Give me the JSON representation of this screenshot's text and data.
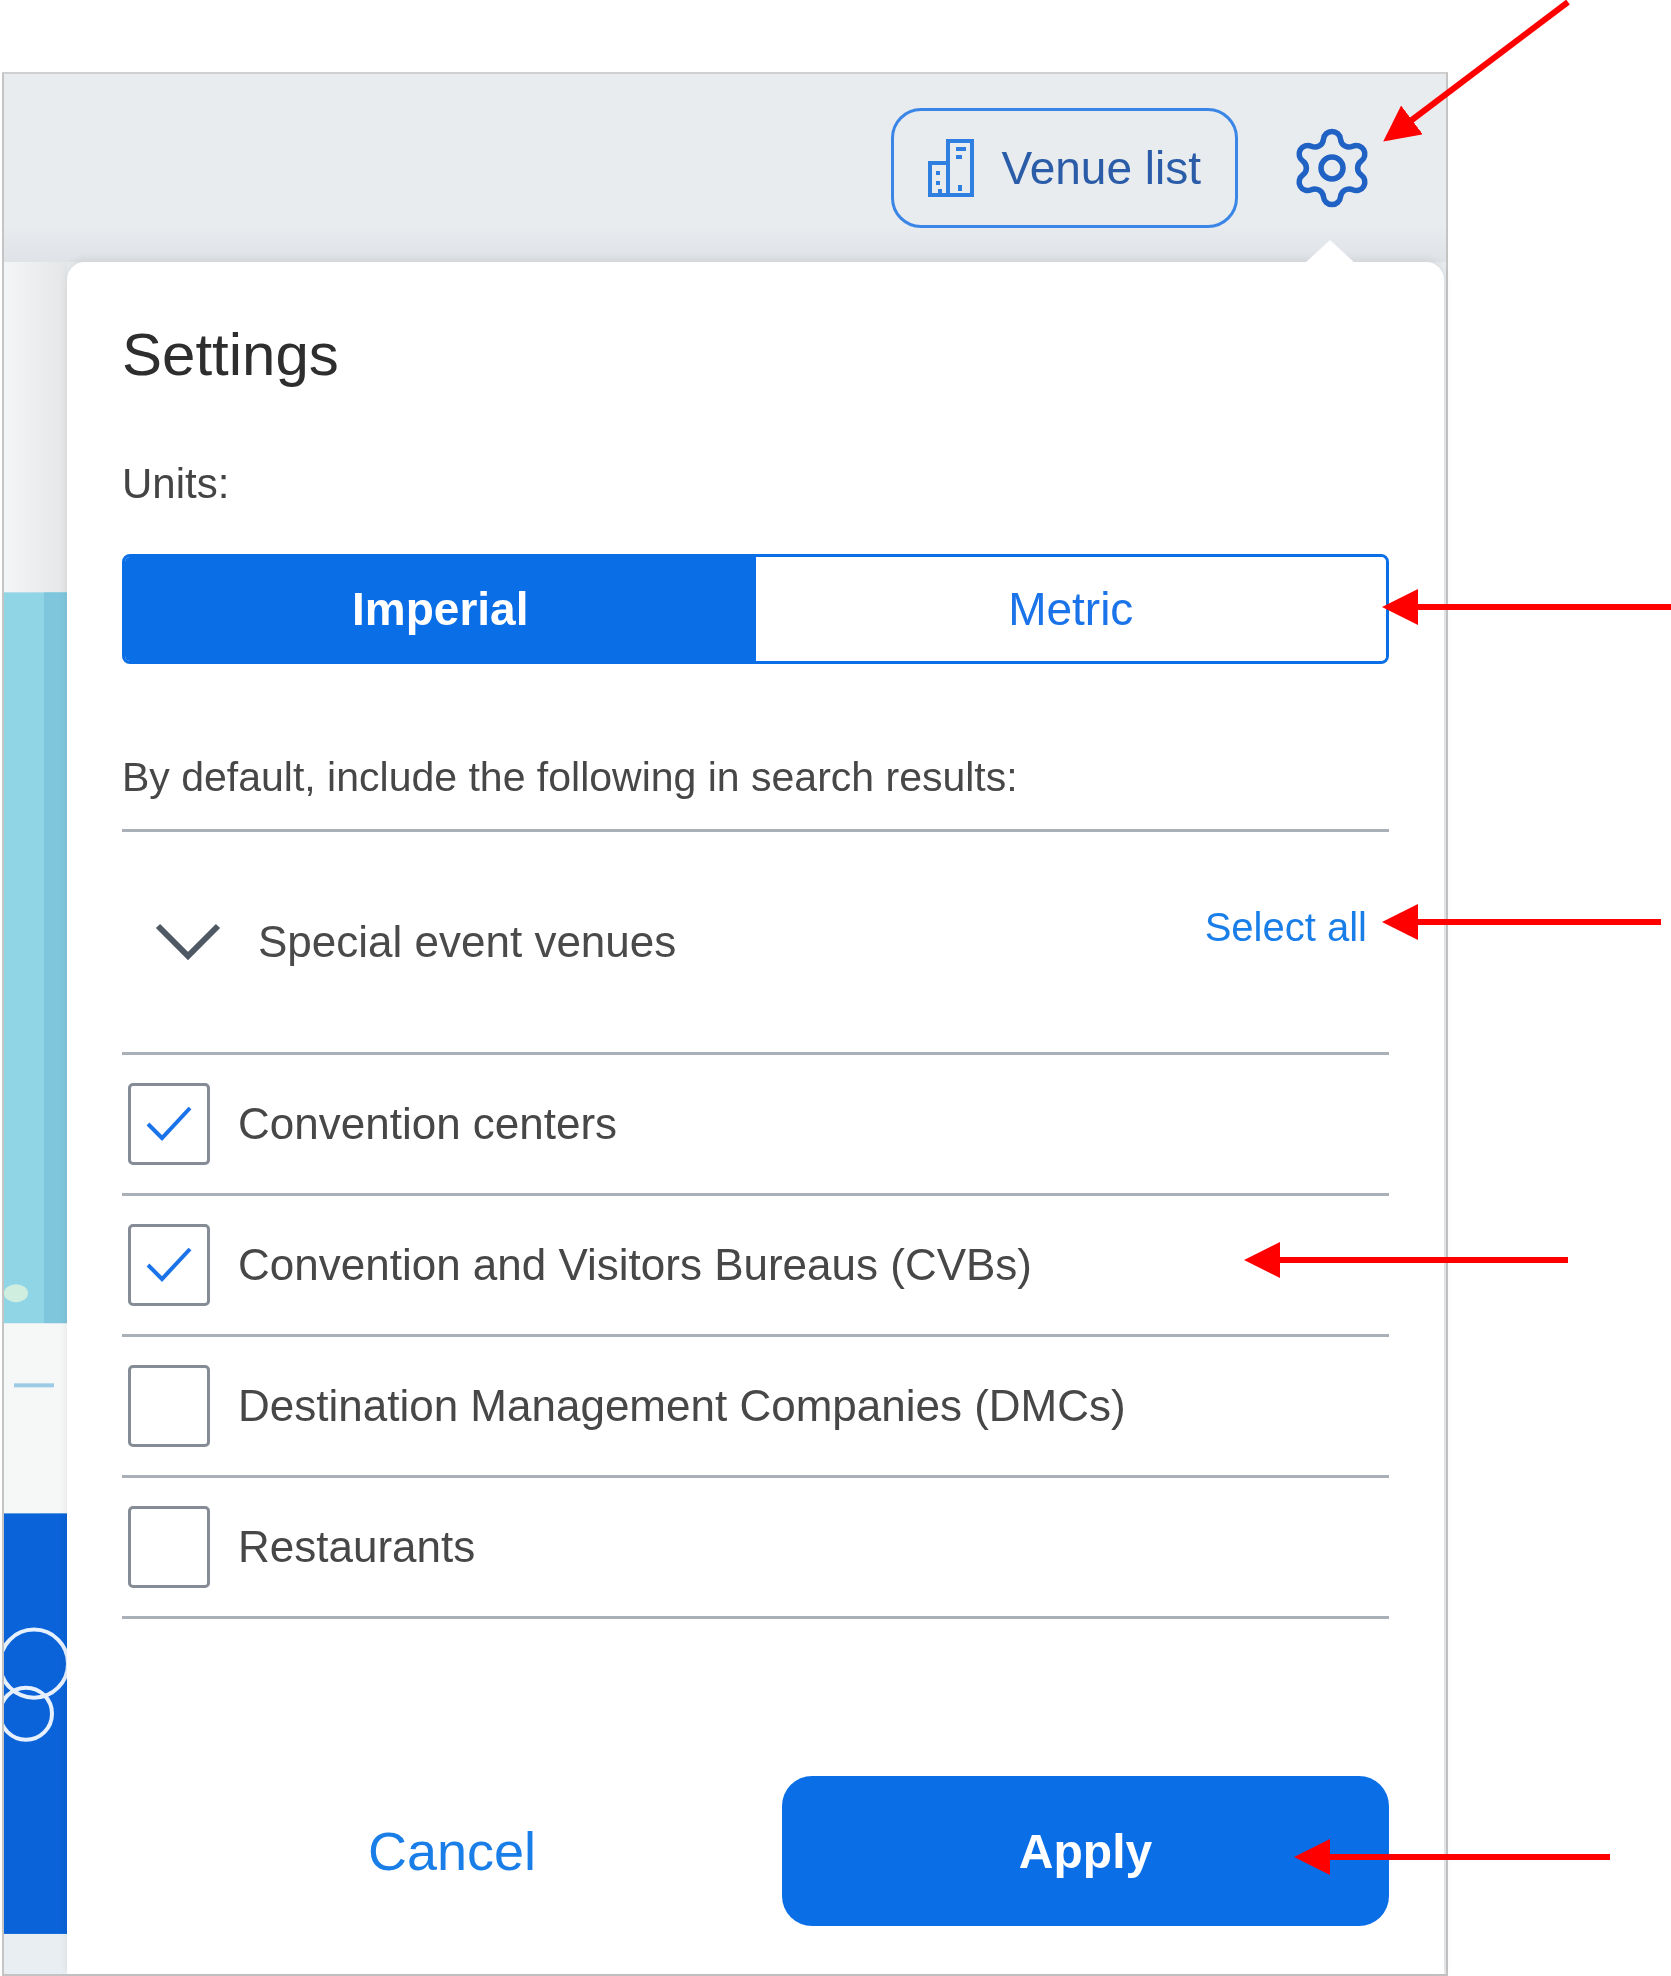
{
  "toolbar": {
    "venue_list_button": "Venue list"
  },
  "settings": {
    "title": "Settings",
    "units_label": "Units:",
    "units": [
      {
        "label": "Imperial",
        "selected": true
      },
      {
        "label": "Metric",
        "selected": false
      }
    ],
    "description": "By default, include the following in search results:",
    "category": {
      "label": "Special event venues",
      "expanded": true,
      "select_all": "Select all"
    },
    "options": [
      {
        "label": "Convention centers",
        "checked": true
      },
      {
        "label": "Convention and Visitors Bureaus (CVBs)",
        "checked": true
      },
      {
        "label": "Destination Management Companies (DMCs)",
        "checked": false
      },
      {
        "label": "Restaurants",
        "checked": false
      }
    ],
    "buttons": {
      "cancel": "Cancel",
      "apply": "Apply"
    }
  }
}
